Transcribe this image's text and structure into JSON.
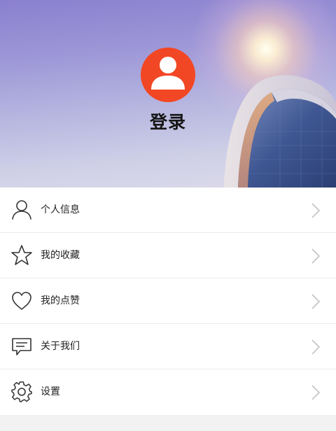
{
  "header": {
    "login_label": "登录"
  },
  "menu": {
    "items": [
      {
        "label": "个人信息",
        "icon": "user-icon"
      },
      {
        "label": "我的收藏",
        "icon": "star-icon"
      },
      {
        "label": "我的点赞",
        "icon": "heart-icon"
      },
      {
        "label": "关于我们",
        "icon": "message-icon"
      },
      {
        "label": "设置",
        "icon": "gear-icon"
      }
    ]
  },
  "colors": {
    "avatar_bg": "#f24724",
    "icon_stroke": "#333333",
    "arrow": "#c4c4c4"
  }
}
